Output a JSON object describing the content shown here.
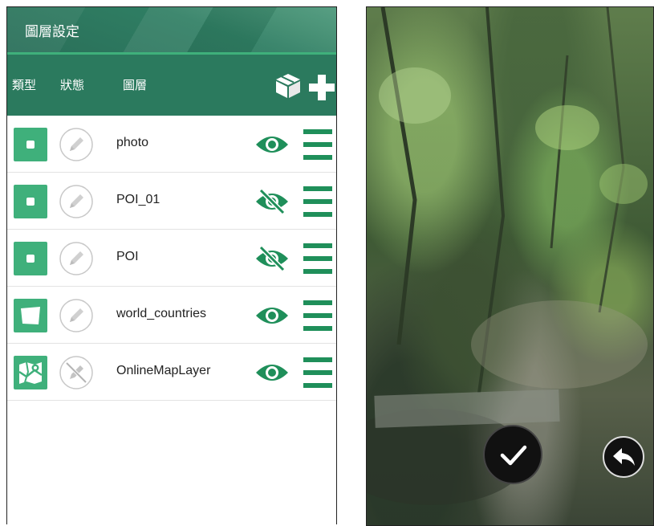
{
  "header": {
    "title": "圖層設定",
    "columns": {
      "type": "類型",
      "status": "狀態",
      "layer": "圖層"
    }
  },
  "layers": [
    {
      "name": "photo",
      "type_icon": "point-icon",
      "editable": true,
      "visible": true
    },
    {
      "name": "POI_01",
      "type_icon": "point-icon",
      "editable": true,
      "visible": false
    },
    {
      "name": "POI",
      "type_icon": "point-icon",
      "editable": true,
      "visible": false
    },
    {
      "name": "world_countries",
      "type_icon": "polygon-icon",
      "editable": true,
      "visible": true
    },
    {
      "name": "OnlineMapLayer",
      "type_icon": "online-map-icon",
      "editable": false,
      "visible": true
    }
  ],
  "icons": {
    "header": [
      "import-box-icon",
      "add-icon"
    ],
    "photo_actions": [
      "check-icon",
      "reply-arrow-icon"
    ]
  },
  "colors": {
    "primary": "#2b7a5e",
    "accent": "#3fb07b",
    "icon_green": "#1f8f5a"
  }
}
